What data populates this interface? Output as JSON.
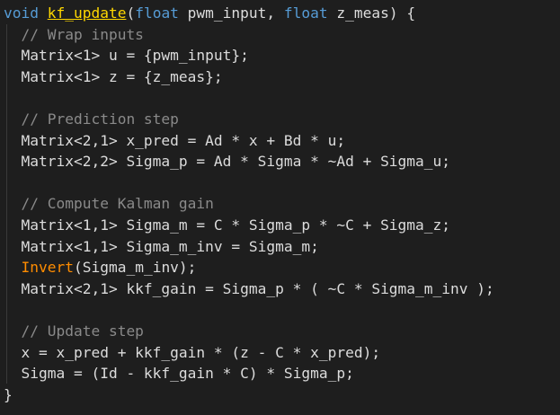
{
  "editor": {
    "lines": [
      {
        "parts": [
          {
            "t": "void",
            "c": "kw"
          },
          {
            "t": " ",
            "c": "plain"
          },
          {
            "t": "kf_update",
            "c": "func-name"
          },
          {
            "t": "(",
            "c": "plain"
          },
          {
            "t": "float",
            "c": "kw"
          },
          {
            "t": " pwm_input, ",
            "c": "plain"
          },
          {
            "t": "float",
            "c": "kw"
          },
          {
            "t": " z_meas) {",
            "c": "plain"
          }
        ]
      },
      {
        "parts": [
          {
            "t": "  // Wrap inputs",
            "c": "cm-dim"
          }
        ]
      },
      {
        "parts": [
          {
            "t": "  Matrix<1> u = {pwm_input};",
            "c": "plain"
          }
        ]
      },
      {
        "parts": [
          {
            "t": "  Matrix<1> z = {z_meas};",
            "c": "plain"
          }
        ]
      },
      {
        "parts": [
          {
            "t": "",
            "c": "plain"
          }
        ]
      },
      {
        "parts": [
          {
            "t": "  // Prediction step",
            "c": "cm-dim"
          }
        ]
      },
      {
        "parts": [
          {
            "t": "  Matrix<2,1> x_pred = Ad * x + Bd * u;",
            "c": "plain"
          }
        ]
      },
      {
        "parts": [
          {
            "t": "  Matrix<2,2> Sigma_p = Ad * Sigma * ~Ad + Sigma_u;",
            "c": "plain"
          }
        ]
      },
      {
        "parts": [
          {
            "t": "",
            "c": "plain"
          }
        ]
      },
      {
        "parts": [
          {
            "t": "  // Compute Kalman gain",
            "c": "cm-dim"
          }
        ]
      },
      {
        "parts": [
          {
            "t": "  Matrix<1,1> Sigma_m = C * Sigma_p * ~C + Sigma_z;",
            "c": "plain"
          }
        ]
      },
      {
        "parts": [
          {
            "t": "  Matrix<1,1> Sigma_m_inv = Sigma_m;",
            "c": "plain"
          }
        ]
      },
      {
        "parts": [
          {
            "t": "  ",
            "c": "plain"
          },
          {
            "t": "Invert",
            "c": "call"
          },
          {
            "t": "(Sigma_m_inv);",
            "c": "plain"
          }
        ]
      },
      {
        "parts": [
          {
            "t": "  Matrix<2,1> kkf_gain = Sigma_p * ( ~C * Sigma_m_inv );",
            "c": "plain"
          }
        ]
      },
      {
        "parts": [
          {
            "t": "",
            "c": "plain"
          }
        ]
      },
      {
        "parts": [
          {
            "t": "  // Update step",
            "c": "cm-dim"
          }
        ]
      },
      {
        "parts": [
          {
            "t": "  x = x_pred + kkf_gain * (z - C * x_pred);",
            "c": "plain"
          }
        ]
      },
      {
        "parts": [
          {
            "t": "  Sigma = (Id - kkf_gain * C) * Sigma_p;",
            "c": "plain"
          }
        ]
      },
      {
        "parts": [
          {
            "t": "}",
            "c": "plain"
          }
        ]
      }
    ]
  },
  "colors": {
    "background": "#1e1e1e",
    "keyword": "#569cd6",
    "function_name": "#ffd700",
    "call": "#ff8c00",
    "comment": "#8a8a8a",
    "text": "#dcdcdc"
  }
}
